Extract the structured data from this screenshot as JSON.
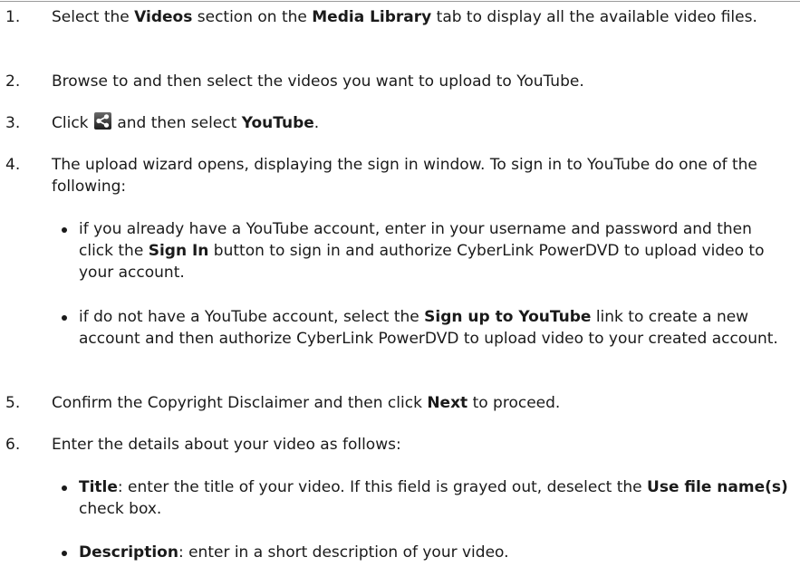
{
  "steps": {
    "s1": {
      "num": "1.",
      "a": "Select the ",
      "b1": "Videos",
      "c": " section on the ",
      "b2": "Media Library",
      "d": " tab to display all the available video files."
    },
    "s2": {
      "num": "2.",
      "a": "Browse to and then select the videos you want to upload to YouTube."
    },
    "s3": {
      "num": "3.",
      "a": "Click ",
      "c": " and then select ",
      "b1": "YouTube",
      "d": "."
    },
    "s4": {
      "num": "4.",
      "a": "The upload wizard opens, displaying the sign in window. To sign in to YouTube do one of the following:"
    },
    "s5": {
      "num": "5.",
      "a": "Confirm the Copyright Disclaimer and then click ",
      "b1": "Next",
      "d": " to proceed."
    },
    "s6": {
      "num": "6.",
      "a": "Enter the details about your video as follows:"
    }
  },
  "bullets": {
    "b1": {
      "a": "if you already have a YouTube account, enter in your username and password and then click the ",
      "b": "Sign In",
      "c": " button to sign in and authorize CyberLink PowerDVD to upload video to your account."
    },
    "b2": {
      "a": "if do not have a YouTube account, select the ",
      "b": "Sign up to YouTube",
      "c": " link to create a new account and then authorize CyberLink PowerDVD to upload video to your created account."
    },
    "b3": {
      "b": "Title",
      "a": ": enter the title of your video. If this field is grayed out, deselect the ",
      "b2": "Use file name(s)",
      "c": " check box."
    },
    "b4": {
      "b": "Description",
      "a": ": enter in a short description of your video."
    }
  },
  "icons": {
    "share": "share-icon"
  }
}
